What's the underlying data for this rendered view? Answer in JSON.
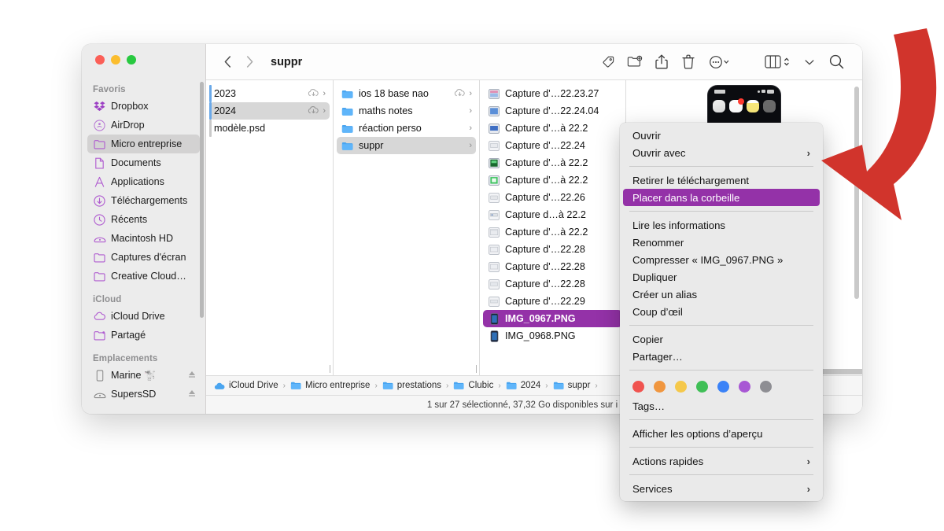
{
  "window": {
    "title": "suppr",
    "traffic_lights": [
      "close",
      "minimize",
      "zoom"
    ]
  },
  "toolbar": {
    "back_label": "‹",
    "forward_label": "›",
    "buttons": [
      {
        "name": "tags-icon",
        "label": "Tags"
      },
      {
        "name": "new-folder-icon",
        "label": "Nouveau dossier"
      },
      {
        "name": "share-icon",
        "label": "Partager"
      },
      {
        "name": "trash-icon",
        "label": "Corbeille"
      },
      {
        "name": "more-actions-icon",
        "label": "Plus"
      },
      {
        "name": "view-column-icon",
        "label": "Affichage"
      },
      {
        "name": "group-chevron-icon",
        "label": "Grouper"
      },
      {
        "name": "search-icon",
        "label": "Rechercher"
      }
    ]
  },
  "sidebar": {
    "sections": [
      {
        "title": "Favoris",
        "items": [
          {
            "label": "Dropbox",
            "icon": "dropbox-icon",
            "selected": false
          },
          {
            "label": "AirDrop",
            "icon": "airdrop-icon",
            "selected": false
          },
          {
            "label": "Micro entreprise",
            "icon": "folder-icon",
            "selected": true
          },
          {
            "label": "Documents",
            "icon": "document-icon",
            "selected": false
          },
          {
            "label": "Applications",
            "icon": "applications-icon",
            "selected": false
          },
          {
            "label": "Téléchargements",
            "icon": "downloads-icon",
            "selected": false
          },
          {
            "label": "Récents",
            "icon": "clock-icon",
            "selected": false
          },
          {
            "label": "Macintosh HD",
            "icon": "disk-icon",
            "selected": false
          },
          {
            "label": "Captures d'écran",
            "icon": "folder-icon",
            "selected": false
          },
          {
            "label": "Creative Cloud…",
            "icon": "folder-icon",
            "selected": false
          }
        ]
      },
      {
        "title": "iCloud",
        "items": [
          {
            "label": "iCloud Drive",
            "icon": "cloud-icon",
            "selected": false
          },
          {
            "label": "Partagé",
            "icon": "shared-folder-icon",
            "selected": false
          }
        ]
      },
      {
        "title": "Emplacements",
        "items": [
          {
            "label": "Marine 🐩",
            "icon": "iphone-icon",
            "selected": false,
            "eject": true
          },
          {
            "label": "SupersSD",
            "icon": "disk-icon",
            "selected": false,
            "eject": true
          }
        ]
      }
    ]
  },
  "columns": {
    "col1": [
      {
        "label": "2023",
        "icon": "folder-icon",
        "cloud": true,
        "chevron": true,
        "selected": false,
        "marker": true
      },
      {
        "label": "2024",
        "icon": "folder-icon",
        "cloud": true,
        "chevron": true,
        "selected": true,
        "marker": true
      },
      {
        "label": "modèle.psd",
        "icon": "file-icon",
        "cloud": false,
        "chevron": false,
        "selected": false,
        "marker": true
      }
    ],
    "col2": [
      {
        "label": "ios 18 base nao",
        "icon": "folder-icon",
        "cloud": true,
        "chevron": true,
        "selected": false
      },
      {
        "label": "maths notes",
        "icon": "folder-icon",
        "cloud": false,
        "chevron": true,
        "selected": false
      },
      {
        "label": "réaction perso",
        "icon": "folder-icon",
        "cloud": false,
        "chevron": true,
        "selected": false
      },
      {
        "label": "suppr",
        "icon": "folder-icon",
        "cloud": false,
        "chevron": true,
        "selected": true
      }
    ],
    "col3": [
      {
        "label": "Capture d'…22.23.27",
        "icon": "screenshot-icon",
        "selected": false
      },
      {
        "label": "Capture d'…22.24.04",
        "icon": "screenshot-icon",
        "selected": false
      },
      {
        "label": "Capture d'…à 22.2",
        "icon": "screenshot-icon",
        "selected": false
      },
      {
        "label": "Capture d'…22.24",
        "icon": "screenshot-icon",
        "selected": false
      },
      {
        "label": "Capture d'…à 22.2",
        "icon": "screenshot-icon-green",
        "selected": false
      },
      {
        "label": "Capture d'…à 22.2",
        "icon": "screenshot-icon-green",
        "selected": false
      },
      {
        "label": "Capture d'…22.26",
        "icon": "screenshot-icon",
        "selected": false
      },
      {
        "label": "Capture d…à 22.2",
        "icon": "screenshot-icon",
        "selected": false
      },
      {
        "label": "Capture d'…à 22.2",
        "icon": "screenshot-icon",
        "selected": false
      },
      {
        "label": "Capture d'…22.28",
        "icon": "screenshot-icon",
        "selected": false
      },
      {
        "label": "Capture d'…22.28",
        "icon": "screenshot-icon",
        "selected": false
      },
      {
        "label": "Capture d'…22.28",
        "icon": "screenshot-icon",
        "selected": false
      },
      {
        "label": "Capture d'…22.29",
        "icon": "screenshot-icon",
        "selected": false
      },
      {
        "label": "IMG_0967.PNG",
        "icon": "iphone-screenshot-icon",
        "selected": true
      },
      {
        "label": "IMG_0968.PNG",
        "icon": "iphone-screenshot-icon",
        "selected": false
      }
    ]
  },
  "pathbar": {
    "crumbs": [
      {
        "label": "iCloud Drive",
        "icon": "cloud-icon"
      },
      {
        "label": "Micro entreprise",
        "icon": "folder-icon"
      },
      {
        "label": "prestations",
        "icon": "folder-icon"
      },
      {
        "label": "Clubic",
        "icon": "folder-icon"
      },
      {
        "label": "2024",
        "icon": "folder-icon"
      },
      {
        "label": "suppr",
        "icon": "folder-icon"
      }
    ],
    "separator": "›"
  },
  "statusbar": {
    "text": "1 sur 27 sélectionné, 37,32 Go disponibles sur i"
  },
  "context_menu": {
    "groups": [
      {
        "items": [
          {
            "label": "Ouvrir",
            "submenu": false,
            "highlighted": false
          },
          {
            "label": "Ouvrir avec",
            "submenu": true,
            "highlighted": false
          }
        ]
      },
      {
        "items": [
          {
            "label": "Retirer le téléchargement",
            "submenu": false,
            "highlighted": false
          },
          {
            "label": "Placer dans la corbeille",
            "submenu": false,
            "highlighted": true
          }
        ]
      },
      {
        "items": [
          {
            "label": "Lire les informations",
            "submenu": false,
            "highlighted": false
          },
          {
            "label": "Renommer",
            "submenu": false,
            "highlighted": false
          },
          {
            "label": "Compresser « IMG_0967.PNG »",
            "submenu": false,
            "highlighted": false
          },
          {
            "label": "Dupliquer",
            "submenu": false,
            "highlighted": false
          },
          {
            "label": "Créer un alias",
            "submenu": false,
            "highlighted": false
          },
          {
            "label": "Coup d’œil",
            "submenu": false,
            "highlighted": false
          }
        ]
      },
      {
        "items": [
          {
            "label": "Copier",
            "submenu": false,
            "highlighted": false
          },
          {
            "label": "Partager…",
            "submenu": false,
            "highlighted": false
          }
        ]
      },
      {
        "tags": [
          "#f0534f",
          "#f0963f",
          "#f5c84a",
          "#3fbf56",
          "#3a82f7",
          "#a857d4",
          "#8e8e93"
        ],
        "items": [
          {
            "label": "Tags…",
            "submenu": false,
            "highlighted": false
          }
        ]
      },
      {
        "items": [
          {
            "label": "Afficher les options d’aperçu",
            "submenu": false,
            "highlighted": false
          }
        ]
      },
      {
        "items": [
          {
            "label": "Actions rapides",
            "submenu": true,
            "highlighted": false
          }
        ]
      },
      {
        "items": [
          {
            "label": "Services",
            "submenu": true,
            "highlighted": false
          }
        ]
      }
    ],
    "highlight_color": "#9432a8"
  },
  "annotation": {
    "arrow_color": "#d1342c",
    "points_to": "Placer dans la corbeille"
  },
  "preview": {
    "filename": "IMG_0967.PNG",
    "app_icons": [
      "#d8d8d8",
      "#f2f2f2",
      "#f7e67a",
      "#5a5a5a"
    ]
  }
}
